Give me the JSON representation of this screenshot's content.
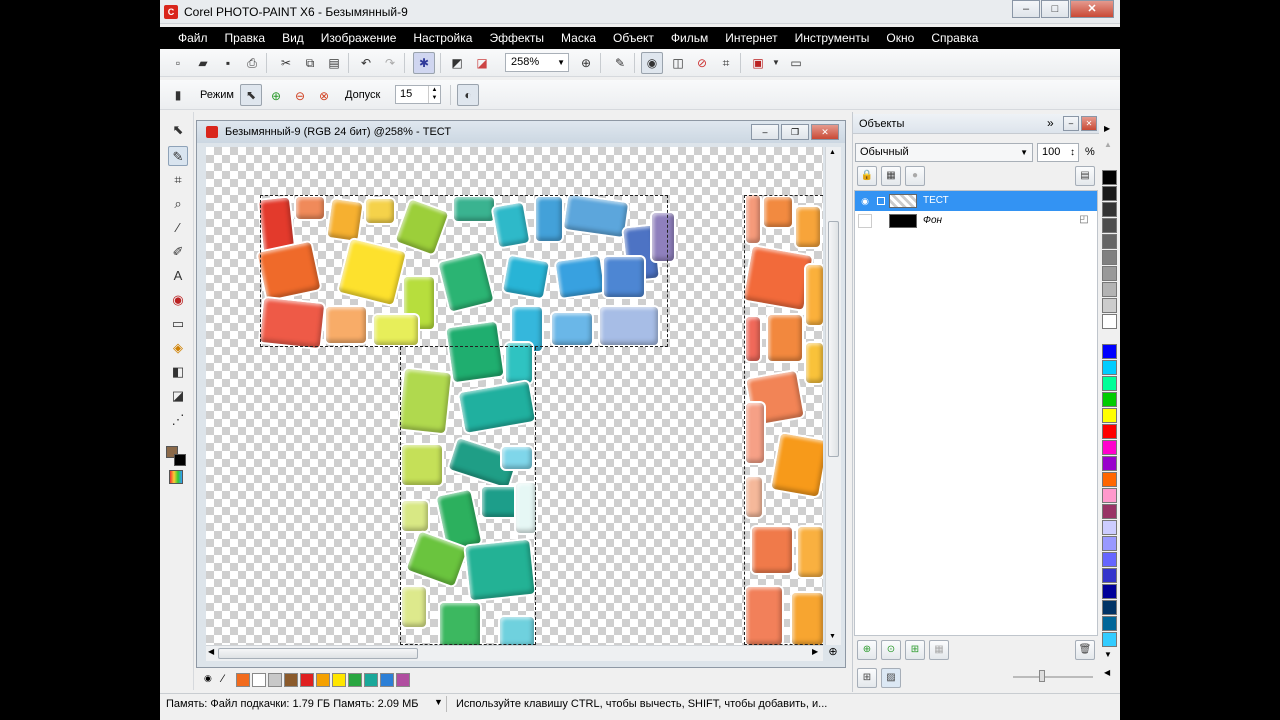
{
  "window": {
    "title": "Corel PHOTO-PAINT X6 - Безымянный-9",
    "app_icon_letter": "C"
  },
  "menu": [
    "Файл",
    "Правка",
    "Вид",
    "Изображение",
    "Настройка",
    "Эффекты",
    "Маска",
    "Объект",
    "Фильм",
    "Интернет",
    "Инструменты",
    "Окно",
    "Справка"
  ],
  "toolbar": {
    "zoom_value": "258%"
  },
  "property_bar": {
    "mode_label": "Режим",
    "tolerance_label": "Допуск",
    "tolerance_value": "15"
  },
  "document": {
    "title": "Безымянный-9 (RGB 24 бит) @258% - ТЕСТ"
  },
  "objects_docker": {
    "title": "Объекты",
    "blend_mode": "Обычный",
    "opacity": "100",
    "opacity_unit": "%",
    "layers": [
      {
        "name": "ТЕСТ",
        "selected": true
      },
      {
        "name": "Фон",
        "selected": false
      }
    ]
  },
  "status": {
    "memory": "Память: Файл подкачки: 1.79 ГБ Память: 2.09 МБ",
    "hint": "Используйте клавишу CTRL, чтобы вычесть, SHIFT, чтобы добавить, и..."
  },
  "bottom_palette": [
    "#f26b1d",
    "#ffffff",
    "#c8c8c8",
    "#8b5a2b",
    "#e02020",
    "#f5a100",
    "#ffe600",
    "#2aa640",
    "#1aa89a",
    "#2c7fd6",
    "#b04ea0"
  ],
  "right_palette": [
    "#000000",
    "#1a1a1a",
    "#333333",
    "#4d4d4d",
    "#666666",
    "#808080",
    "#999999",
    "#b3b3b3",
    "#cccccc",
    "#ffffff",
    "#0000ff",
    "#00ccff",
    "#00ff99",
    "#00cc00",
    "#ffff00",
    "#ff0000",
    "#ff00cc",
    "#9900cc",
    "#ff6600",
    "#ff99cc",
    "#993366",
    "#ccccff",
    "#9999ff",
    "#6666ff",
    "#3333cc",
    "#000099",
    "#003366",
    "#006699",
    "#33ccff"
  ]
}
